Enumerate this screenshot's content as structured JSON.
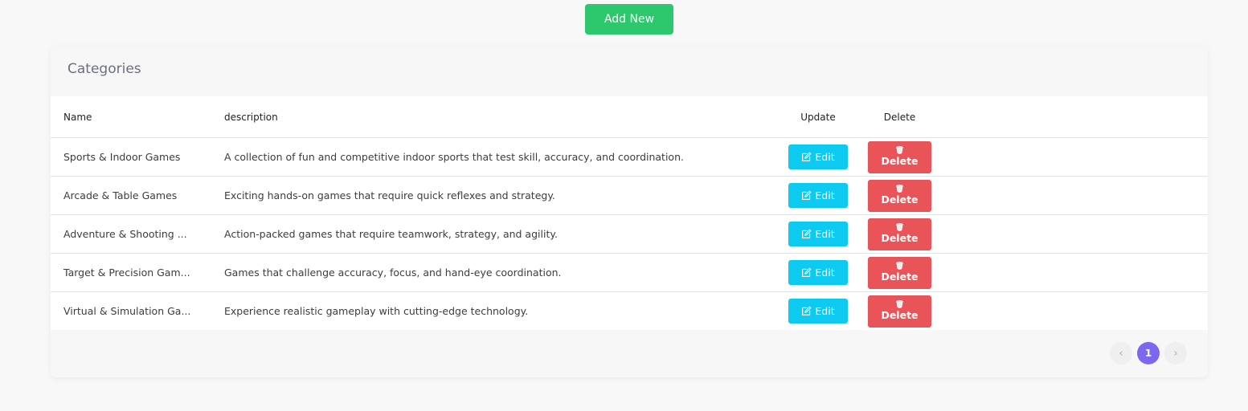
{
  "toolbar": {
    "add_label": "Add New"
  },
  "card": {
    "title": "Categories"
  },
  "table": {
    "headers": {
      "name": "Name",
      "description": "description",
      "update": "Update",
      "delete": "Delete"
    },
    "rows": [
      {
        "name": "Sports & Indoor Games",
        "description": "A collection of fun and competitive indoor sports that test skill, accuracy, and coordination.",
        "edit_label": "Edit",
        "delete_label": "Delete"
      },
      {
        "name": "Arcade & Table Games",
        "description": "Exciting hands-on games that require quick reflexes and strategy.",
        "edit_label": "Edit",
        "delete_label": "Delete"
      },
      {
        "name": "Adventure & Shooting ...",
        "description": "Action-packed games that require teamwork, strategy, and agility.",
        "edit_label": "Edit",
        "delete_label": "Delete"
      },
      {
        "name": "Target & Precision Gam...",
        "description": "Games that challenge accuracy, focus, and hand-eye coordination.",
        "edit_label": "Edit",
        "delete_label": "Delete"
      },
      {
        "name": "Virtual & Simulation Ga...",
        "description": "Experience realistic gameplay with cutting-edge technology.",
        "edit_label": "Edit",
        "delete_label": "Delete"
      }
    ]
  },
  "pagination": {
    "prev": "‹",
    "current": "1",
    "next": "›"
  },
  "colors": {
    "add": "#2dc76d",
    "edit": "#0dcaf0",
    "delete": "#e85458",
    "page_active": "#7b68ee"
  },
  "icons": {
    "edit": "edit-icon",
    "delete": "trash-icon"
  }
}
